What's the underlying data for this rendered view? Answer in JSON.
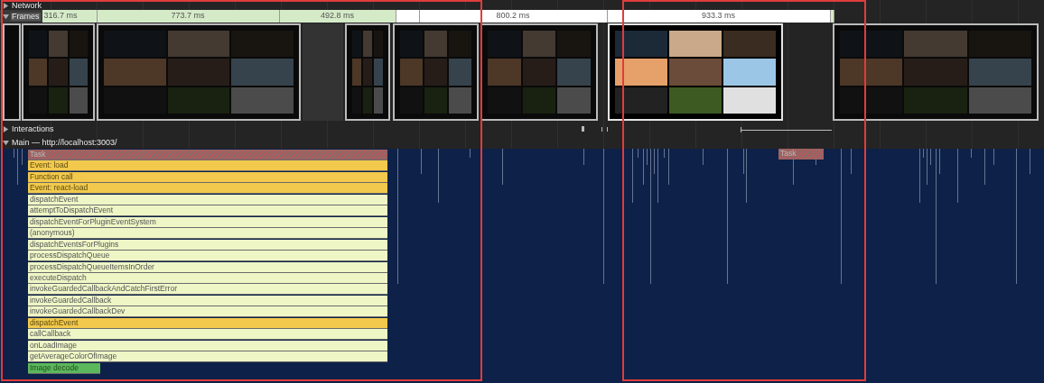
{
  "tracks": {
    "network": {
      "label": "Network",
      "expanded": false
    },
    "frames": {
      "label": "Frames",
      "expanded": true
    },
    "interactions": {
      "label": "Interactions",
      "expanded": false
    },
    "main": {
      "label": "Main — http://localhost:3003/",
      "expanded": true
    }
  },
  "frames": [
    {
      "label": "316.7 ms",
      "kind": "presented"
    },
    {
      "label": "773.7 ms",
      "kind": "presented"
    },
    {
      "label": "492.8 ms",
      "kind": "presented"
    },
    {
      "kind": "idle"
    },
    {
      "label": "800.2 ms",
      "kind": "idle"
    },
    {
      "label": "933.3 ms",
      "kind": "idle"
    },
    {
      "kind": "presented"
    }
  ],
  "thumbnails": [
    {
      "kind": "dim"
    },
    {
      "kind": "dim"
    },
    {
      "kind": "dim"
    },
    {
      "kind": "blank"
    },
    {
      "kind": "dim"
    },
    {
      "kind": "dim"
    },
    {
      "kind": "dim"
    },
    {
      "kind": "bright"
    },
    {
      "kind": "dim"
    }
  ],
  "flame": [
    {
      "label": "Task",
      "kind": "task"
    },
    {
      "label": "Event: load",
      "kind": "event"
    },
    {
      "label": "Function call",
      "kind": "event"
    },
    {
      "label": "Event: react-load",
      "kind": "event"
    },
    {
      "label": "dispatchEvent",
      "kind": "function"
    },
    {
      "label": "attemptToDispatchEvent",
      "kind": "function"
    },
    {
      "label": "dispatchEventForPluginEventSystem",
      "kind": "function"
    },
    {
      "label": "(anonymous)",
      "kind": "function"
    },
    {
      "label": "dispatchEventsForPlugins",
      "kind": "function"
    },
    {
      "label": "processDispatchQueue",
      "kind": "function"
    },
    {
      "label": "processDispatchQueueItemsInOrder",
      "kind": "function"
    },
    {
      "label": "executeDispatch",
      "kind": "function"
    },
    {
      "label": "invokeGuardedCallbackAndCatchFirstError",
      "kind": "function"
    },
    {
      "label": "invokeGuardedCallback",
      "kind": "function"
    },
    {
      "label": "invokeGuardedCallbackDev",
      "kind": "function"
    },
    {
      "label": "dispatchEvent",
      "kind": "event"
    },
    {
      "label": "callCallback",
      "kind": "function"
    },
    {
      "label": "onLoadImage",
      "kind": "function"
    },
    {
      "label": "getAverageColorOfImage",
      "kind": "function"
    },
    {
      "label": "Image decode",
      "kind": "decode"
    }
  ],
  "late_task": {
    "label": "Task",
    "kind": "task"
  }
}
